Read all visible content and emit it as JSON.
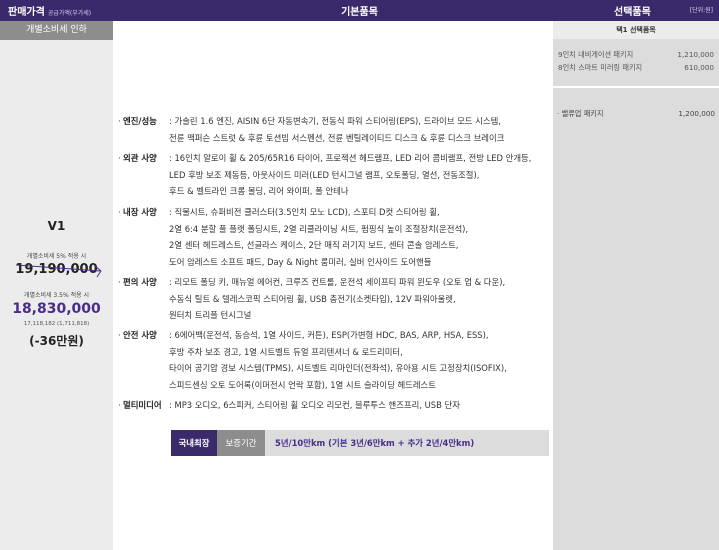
{
  "header": {
    "price_title": "판매가격",
    "price_note": "공급가액(부가세)",
    "basic_title": "기본품목",
    "option_title": "선택품목",
    "unit": "[단위:원]"
  },
  "left": {
    "tab": "개별소비세 인하",
    "model": "V1",
    "tax5_label": "개별소비세 5% 적용 시",
    "tax5_price": "19,190,000",
    "tax35_label": "개별소비세 3.5% 적용 시",
    "tax35_price": "18,830,000",
    "tax35_sub": "17,118,182 (1,711,818)",
    "discount": "(-36만원)"
  },
  "specs": [
    {
      "category": "엔진/성능",
      "lines": [
        ": 가솔린 1.6 엔진, AISIN 6단 자동변속기, 전동식 파워 스티어링(EPS), 드라이브 모드 시스템,",
        "전륜 맥퍼슨 스트럿 & 후륜 토션빔 서스펜션, 전륜 벤틸레이티드 디스크 & 후륜 디스크 브레이크"
      ]
    },
    {
      "category": "외관 사양",
      "lines": [
        ": 16인치 알로이 휠 & 205/65R16 타이어, 프로젝션 헤드램프, LED 리어 콤비램프, 전방 LED 안개등,",
        "LED 후방 보조 제동등, 아웃사이드 미러(LED 턴시그널 램프, 오토폴딩, 열선, 전동조절),",
        "후드 & 벨트라인 크롬 몰딩, 리어 와이퍼, 폴 안테나"
      ]
    },
    {
      "category": "내장 사양",
      "lines": [
        ": 직물시트, 슈퍼비전 클러스터(3.5인치 모노 LCD), 스포티 D컷 스티어링 휠,",
        "2열 6:4 분할 풀 플랫 폴딩시트, 2열 리클라이닝 시트, 펌핑식 높이 조절장치(운전석),",
        "2열 센터 헤드레스트, 선글라스 케이스, 2단 매직 러기지 보드, 센터 콘솔 암레스트,",
        "도어 암레스트 소프트 패드, Day & Night 룸미러, 실버 인사이드 도어핸들"
      ]
    },
    {
      "category": "편의 사양",
      "lines": [
        ": 리모트 폴딩 키, 매뉴얼 에어컨, 크루즈 컨트롤, 운전석 세이프티 파워 윈도우 (오토 업 & 다운),",
        "수동식 틸트 & 텔레스코픽 스티어링 휠, USB 충전기(소켓타입), 12V 파워아울렛,",
        "원터치 트리플 턴시그널"
      ]
    },
    {
      "category": "안전 사양",
      "lines": [
        ": 6에어백(운전석, 동승석, 1열 사이드, 커튼), ESP(가변형 HDC, BAS, ARP, HSA, ESS),",
        "후방 주차 보조 경고, 1열 시트벨트 듀얼 프리텐셔너 & 로드리미터,",
        "타이어 공기압 경보 시스템(TPMS), 시트벨트 리마인더(전좌석), 유아용 시트 고정장치(ISOFIX),",
        "스피드센싱 오토 도어록(이머전시 언락 포함), 1열 시트 슬라이딩 헤드레스트"
      ]
    },
    {
      "category": "멀티미디어",
      "lines": [
        ": MP3 오디오, 6스피커, 스티어링 휠 오디오 리모컨, 블루투스 핸즈프리, USB 단자"
      ]
    }
  ],
  "warranty": {
    "badge1": "국내최장",
    "badge2": "보증기간",
    "text": "5년/10만km (기본 3년/6만km + 추가 2년/4만km)"
  },
  "options": {
    "tab": "택1 선택품목",
    "items": [
      {
        "name": "9인치 내비게이션 패키지",
        "price": "1,210,000"
      },
      {
        "name": "8인치 스마트 미러링 패키지",
        "price": "610,000"
      }
    ],
    "package": {
      "name": "· 밸류업 패키지",
      "price": "1,200,000"
    }
  }
}
